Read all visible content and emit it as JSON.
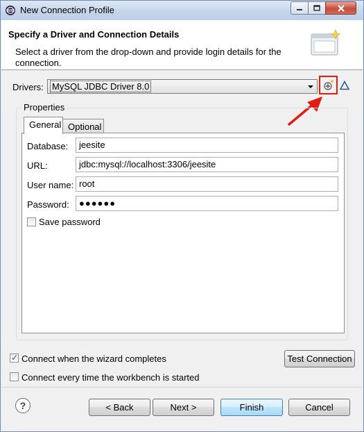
{
  "window": {
    "title": "New Connection Profile"
  },
  "banner": {
    "title": "Specify a Driver and Connection Details",
    "description": "Select a driver from the drop-down and provide login details for the connection."
  },
  "drivers": {
    "label": "Drivers:",
    "selected": "MySQL JDBC Driver 8.0"
  },
  "properties": {
    "title": "Properties",
    "tabs": [
      {
        "label": "General"
      },
      {
        "label": "Optional"
      }
    ],
    "fields": {
      "database": {
        "label": "Database:",
        "value": "jeesite"
      },
      "url": {
        "label": "URL:",
        "value": "jdbc:mysql://localhost:3306/jeesite"
      },
      "username": {
        "label": "User name:",
        "value": "root"
      },
      "password": {
        "label": "Password:",
        "value": "●●●●●●"
      }
    },
    "save_password": {
      "label": "Save password",
      "checked": false
    }
  },
  "options": {
    "connect_on_finish": {
      "label": "Connect when the wizard completes",
      "checked": true
    },
    "connect_every_start": {
      "label": "Connect every time the workbench is started",
      "checked": false
    }
  },
  "buttons": {
    "test_connection": "Test Connection",
    "back": "< Back",
    "next": "Next >",
    "finish": "Finish",
    "cancel": "Cancel",
    "help": "?"
  },
  "colors": {
    "highlight_red": "#e31b10",
    "default_button_border": "#3c7fb1"
  }
}
